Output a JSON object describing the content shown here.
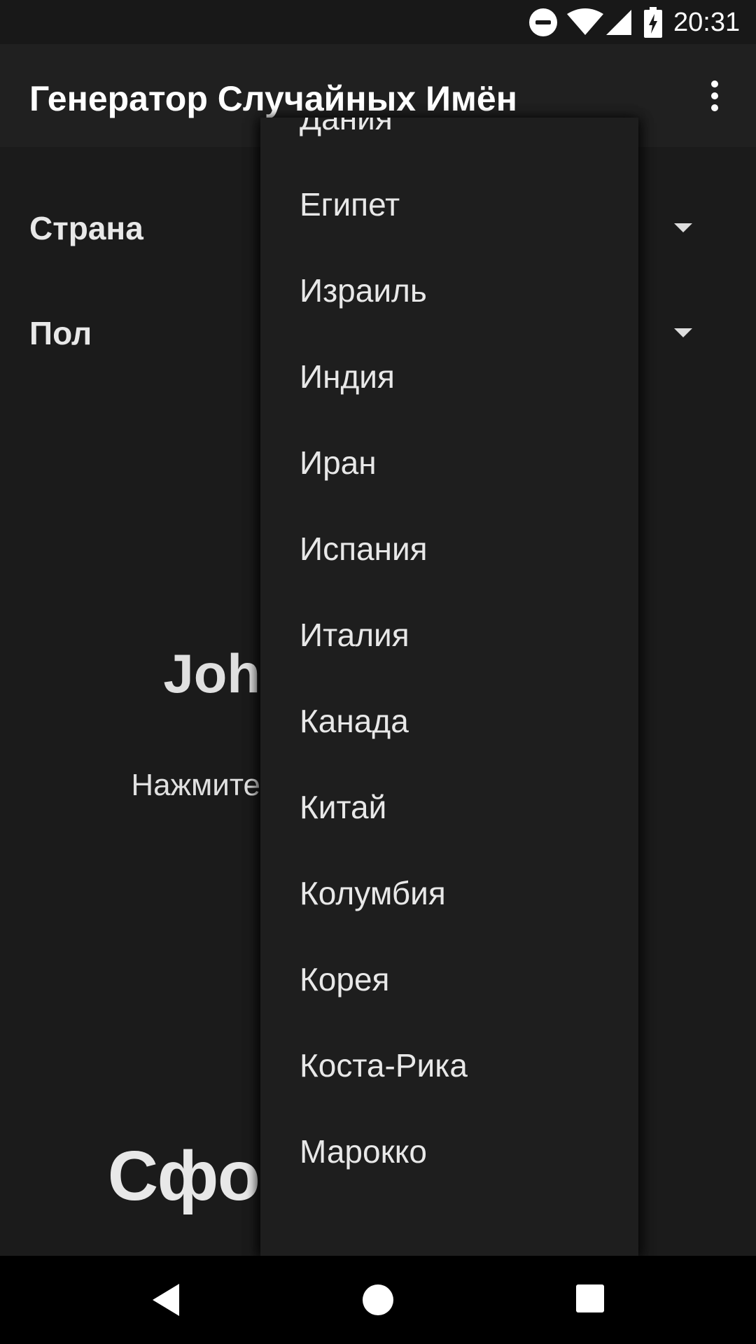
{
  "status_bar": {
    "time": "20:31",
    "icons": [
      "do-not-disturb-icon",
      "wifi-icon",
      "signal-icon",
      "battery-charging-icon"
    ]
  },
  "app_bar": {
    "title": "Генератор Случайных Имён",
    "overflow_icon": "more-vert-icon"
  },
  "form": {
    "country_label": "Страна",
    "gender_label": "Пол"
  },
  "main": {
    "name_visible": "Joh",
    "hint_visible": "Нажмите",
    "big_visible": "Сфо"
  },
  "dropdown": {
    "items": [
      "Дания",
      "Египет",
      "Израиль",
      "Индия",
      "Иран",
      "Испания",
      "Италия",
      "Канада",
      "Китай",
      "Колумбия",
      "Корея",
      "Коста-Рика",
      "Марокко"
    ]
  },
  "colors": {
    "background": "#1b1b1b",
    "app_bar": "#202020",
    "popup": "#1e1e1e",
    "text": "#e8e8e8"
  }
}
